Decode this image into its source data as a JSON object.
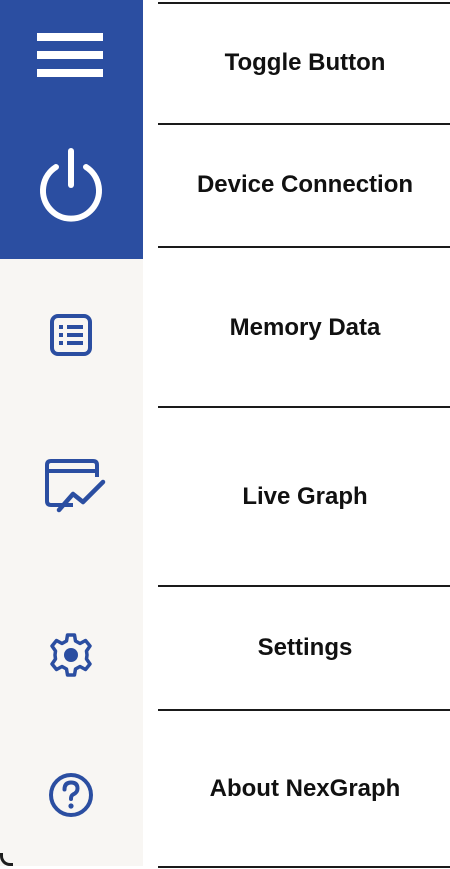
{
  "sidebar": {
    "items": [
      {
        "id": "toggle",
        "icon": "hamburger-menu-icon",
        "label": "Toggle Button"
      },
      {
        "id": "connection",
        "icon": "power-icon",
        "label": "Device Connection"
      },
      {
        "id": "memory",
        "icon": "list-icon",
        "label": "Memory Data"
      },
      {
        "id": "graph",
        "icon": "live-graph-icon",
        "label": "Live Graph"
      },
      {
        "id": "settings",
        "icon": "gear-icon",
        "label": "Settings"
      },
      {
        "id": "about",
        "icon": "help-circle-icon",
        "label": "About NexGraph"
      }
    ]
  },
  "colors": {
    "rail_active": "#2b4ea1",
    "rail_inactive": "#f8f6f3",
    "icon_white": "#ffffff",
    "icon_blue": "#2b4ea1",
    "text": "#111111"
  }
}
